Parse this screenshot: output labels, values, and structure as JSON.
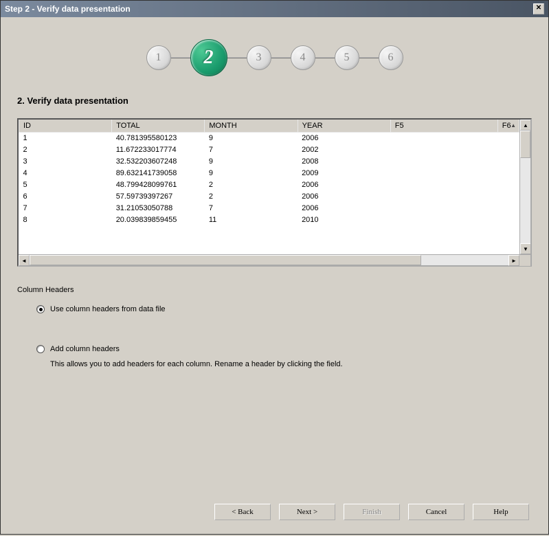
{
  "window": {
    "title": "Step 2 - Verify data presentation"
  },
  "wizard": {
    "steps": [
      "1",
      "2",
      "3",
      "4",
      "5",
      "6"
    ],
    "active_index": 1
  },
  "heading": "2. Verify data presentation",
  "table": {
    "columns": [
      "ID",
      "TOTAL",
      "MONTH",
      "YEAR",
      "F5",
      "F6"
    ],
    "rows": [
      {
        "id": "1",
        "total": "40.781395580123",
        "month": "9",
        "year": "2006",
        "f5": "",
        "f6": ""
      },
      {
        "id": "2",
        "total": "11.672233017774",
        "month": "7",
        "year": "2002",
        "f5": "",
        "f6": ""
      },
      {
        "id": "3",
        "total": "32.532203607248",
        "month": "9",
        "year": "2008",
        "f5": "",
        "f6": ""
      },
      {
        "id": "4",
        "total": "89.632141739058",
        "month": "9",
        "year": "2009",
        "f5": "",
        "f6": ""
      },
      {
        "id": "5",
        "total": "48.799428099761",
        "month": "2",
        "year": "2006",
        "f5": "",
        "f6": ""
      },
      {
        "id": "6",
        "total": "57.59739397267",
        "month": "2",
        "year": "2006",
        "f5": "",
        "f6": ""
      },
      {
        "id": "7",
        "total": "31.21053050788",
        "month": "7",
        "year": "2006",
        "f5": "",
        "f6": ""
      },
      {
        "id": "8",
        "total": "20.039839859455",
        "month": "11",
        "year": "2010",
        "f5": "",
        "f6": ""
      }
    ]
  },
  "column_headers_section": {
    "label": "Column Headers",
    "option_use_file": "Use column headers from data file",
    "option_add": "Add column headers",
    "option_add_desc": "This allows you to add headers for each column. Rename a header by clicking the field.",
    "selected": "use_file"
  },
  "buttons": {
    "back": "< Back",
    "next": "Next >",
    "finish": "Finish",
    "cancel": "Cancel",
    "help": "Help"
  }
}
